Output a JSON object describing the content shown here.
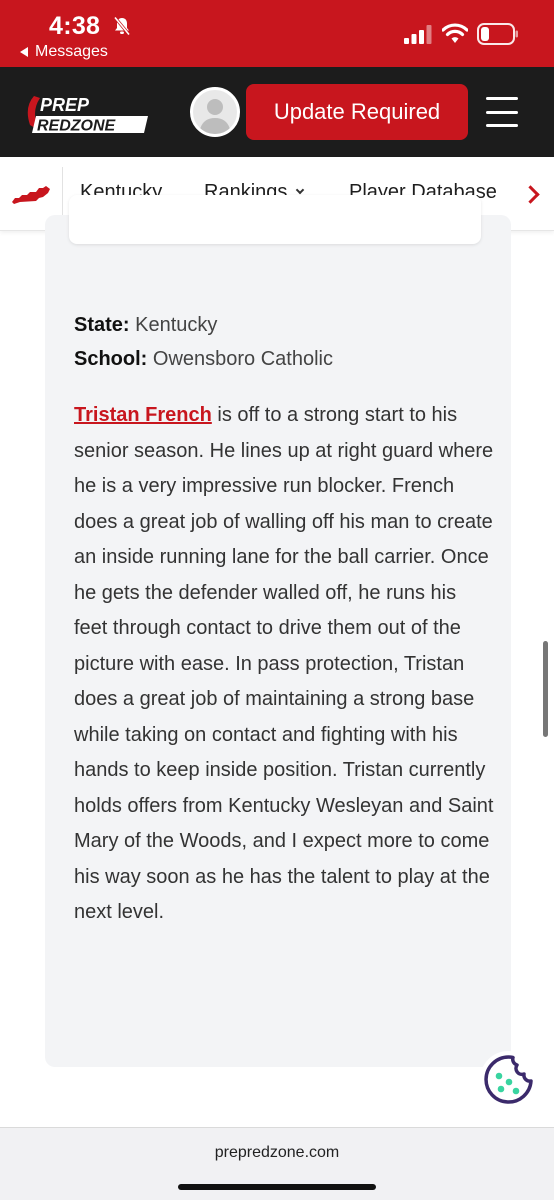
{
  "status_bar": {
    "time": "4:38",
    "back_app": "Messages",
    "icons": [
      "bell-slash-icon",
      "signal-icon",
      "wifi-icon",
      "battery-icon"
    ]
  },
  "header": {
    "logo_text": [
      "PREP",
      "REDZONE"
    ],
    "update_button": "Update Required",
    "icons": [
      "avatar",
      "hamburger-menu-icon"
    ]
  },
  "sub_nav": {
    "items": [
      "Kentucky",
      "Rankings",
      "Player Database"
    ],
    "icons": [
      "kentucky-state-map-icon",
      "chevron-down-icon",
      "chevron-right-icon"
    ]
  },
  "article": {
    "state_label": "State:",
    "state_value": "Kentucky",
    "school_label": "School:",
    "school_value": "Owensboro Catholic",
    "player_name": "Tristan French",
    "body": " is off to a strong start to his senior season. He lines up at right guard where he is a very impressive run blocker. French does a great job of walling off his man to create an inside running lane for the ball carrier. Once he gets the defender walled off, he runs his feet through contact to drive them out of the picture with ease. In pass protection, Tristan does a great job of maintaining a strong base while taking on contact and fighting with his hands to keep inside position. Tristan currently holds offers from Kentucky Wesleyan and Saint Mary of the Woods, and I expect more to come his way soon as he has the talent to play at the next level."
  },
  "browser": {
    "url": "prepredzone.com"
  },
  "colors": {
    "brand_red": "#c8161e",
    "header_dark": "#1c1c1c",
    "card_bg": "#f3f4f6",
    "cookie_purple": "#3b2a6b",
    "cookie_green": "#39d4a0"
  }
}
